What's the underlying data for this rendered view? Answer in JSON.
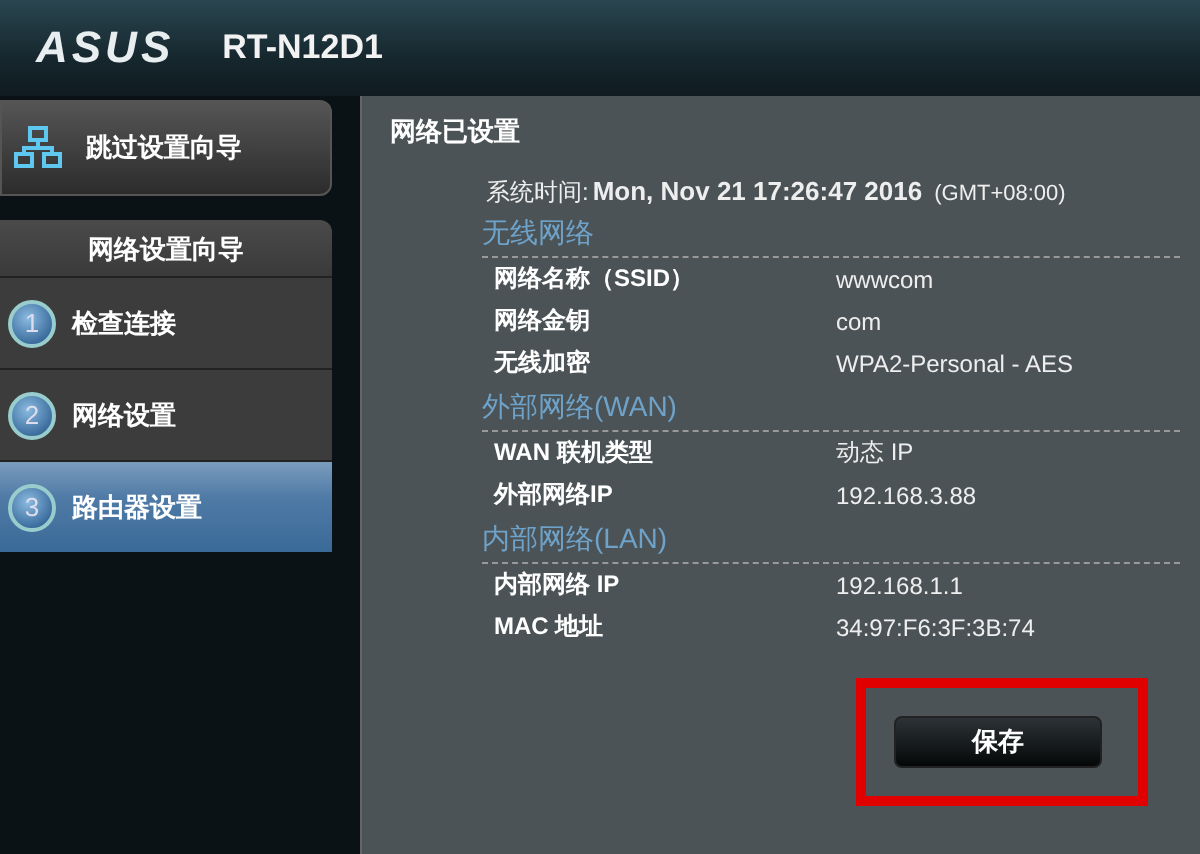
{
  "header": {
    "brand": "ASUS",
    "model": "RT-N12D1"
  },
  "sidebar": {
    "skip_button": "跳过设置向导",
    "wizard_title": "网络设置向导",
    "steps": [
      {
        "number": "1",
        "label": "检查连接",
        "selected": false
      },
      {
        "number": "2",
        "label": "网络设置",
        "selected": false
      },
      {
        "number": "3",
        "label": "路由器设置",
        "selected": true
      }
    ]
  },
  "panel": {
    "title": "网络已设置",
    "system_time_label": "系统时间:",
    "system_time": "Mon, Nov 21 17:26:47 2016",
    "timezone": "(GMT+08:00)",
    "sections": [
      {
        "heading": "无线网络",
        "rows": [
          {
            "label": "网络名称（SSID）",
            "value": "wwwcom"
          },
          {
            "label": "网络金钥",
            "value": "com"
          },
          {
            "label": "无线加密",
            "value": "WPA2-Personal - AES"
          }
        ]
      },
      {
        "heading": "外部网络(WAN)",
        "rows": [
          {
            "label": "WAN 联机类型",
            "value": "动态 IP"
          },
          {
            "label": "外部网络IP",
            "value": "192.168.3.88"
          }
        ]
      },
      {
        "heading": "内部网络(LAN)",
        "rows": [
          {
            "label": "内部网络 IP",
            "value": "192.168.1.1"
          },
          {
            "label": "MAC 地址",
            "value": "34:97:F6:3F:3B:74"
          }
        ]
      }
    ],
    "save_button": {
      "label": "保存",
      "highlighted": true
    }
  }
}
